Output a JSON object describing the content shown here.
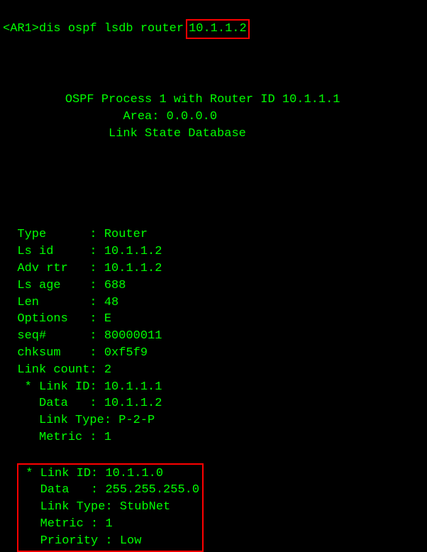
{
  "prompt": {
    "device": "<AR1>",
    "command": "dis ospf lsdb router",
    "argument": "10.1.1.2"
  },
  "header": {
    "line1": "OSPF Process 1 with Router ID 10.1.1.1",
    "line2": "Area: 0.0.0.0",
    "line3": "Link State Database"
  },
  "fields": {
    "type": {
      "label": "Type",
      "value": "Router"
    },
    "lsid": {
      "label": "Ls id",
      "value": "10.1.1.2"
    },
    "advrtr": {
      "label": "Adv rtr",
      "value": "10.1.1.2"
    },
    "lsage": {
      "label": "Ls age",
      "value": "688"
    },
    "len": {
      "label": "Len",
      "value": "48"
    },
    "options": {
      "label": "Options",
      "value": " E"
    },
    "seq": {
      "label": "seq#",
      "value": "80000011"
    },
    "chksum": {
      "label": "chksum",
      "value": "0xf5f9"
    },
    "linkcount": {
      "label": "Link count",
      "value": "2"
    }
  },
  "links": [
    {
      "linkid": {
        "label": "* Link ID",
        "value": "10.1.1.1"
      },
      "data": {
        "label": "Data",
        "value": "10.1.1.2"
      },
      "linktype": {
        "label": "Link Type",
        "value": "P-2-P"
      },
      "metric": {
        "label": "Metric",
        "value": "1"
      }
    },
    {
      "linkid": {
        "label": "* Link ID",
        "value": "10.1.1.0"
      },
      "data": {
        "label": "Data",
        "value": "255.255.255.0"
      },
      "linktype": {
        "label": "Link Type",
        "value": "StubNet"
      },
      "metric": {
        "label": "Metric",
        "value": "1"
      },
      "priority": {
        "label": "Priority",
        "value": "Low"
      }
    }
  ]
}
